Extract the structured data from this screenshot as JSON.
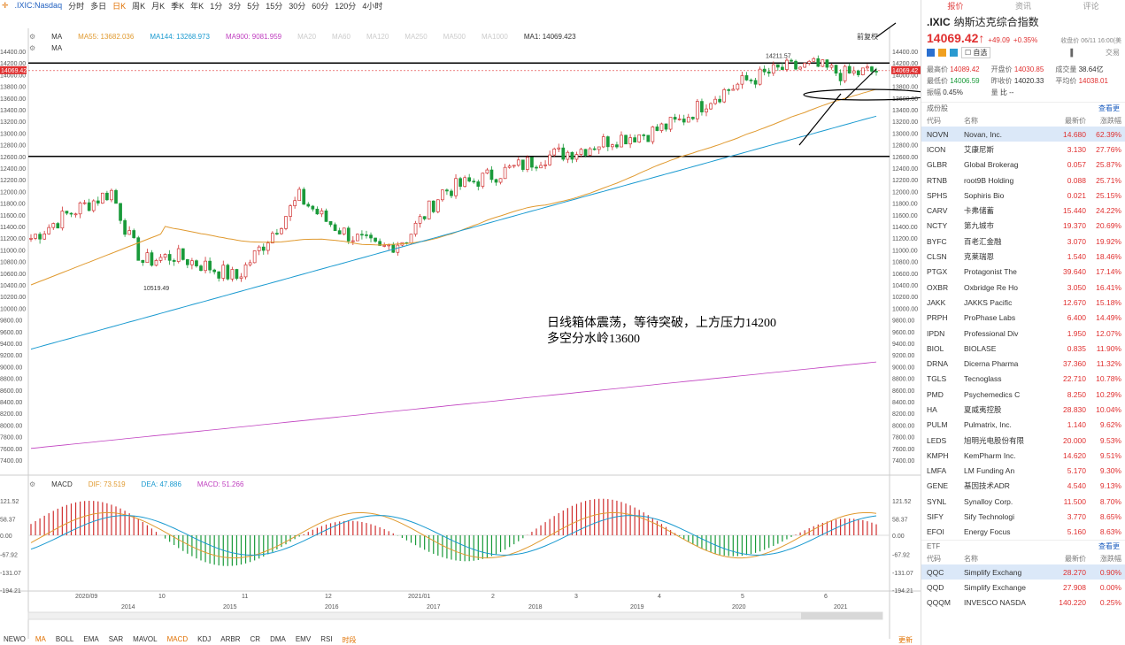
{
  "toolbar": {
    "symbol": ".IXIC:Nasdaq",
    "periods": [
      "分时",
      "多日",
      "日K",
      "周K",
      "月K",
      "季K",
      "年K",
      "1分",
      "3分",
      "5分",
      "15分",
      "30分",
      "60分",
      "120分",
      "4小时"
    ],
    "active_period": "日K"
  },
  "ma_bar": {
    "label": "MA",
    "items": [
      {
        "name": "MA55: 13682.036",
        "color": "#e09a30"
      },
      {
        "name": "MA144: 13268.973",
        "color": "#1a9ad0"
      },
      {
        "name": "MA900: 9081.959",
        "color": "#c040c0"
      },
      {
        "name": "MA20",
        "color": "#ccc"
      },
      {
        "name": "MA60",
        "color": "#ccc"
      },
      {
        "name": "MA120",
        "color": "#ccc"
      },
      {
        "name": "MA250",
        "color": "#ccc"
      },
      {
        "name": "MA500",
        "color": "#ccc"
      },
      {
        "name": "MA1000",
        "color": "#ccc"
      },
      {
        "name": "MA1: 14069.423",
        "color": "#333"
      }
    ],
    "adjust": "前复权",
    "second_label": "MA"
  },
  "macd_bar": {
    "label": "MACD",
    "dif": "DIF: 73.519",
    "dea": "DEA: 47.886",
    "macd": "MACD: 51.266"
  },
  "price_labels": {
    "left": "14069.42",
    "right": "14069.42",
    "high": "14211.57",
    "low": "10519.49"
  },
  "annotation": {
    "line1": "日线箱体震荡，等待突破，上方压力14200",
    "line2": "多空分水岭13600"
  },
  "price_axis": [
    "14400.00",
    "14200.00",
    "14000.00",
    "13800.00",
    "13600.00",
    "13400.00",
    "13200.00",
    "13000.00",
    "12800.00",
    "12600.00",
    "12400.00",
    "12200.00",
    "12000.00",
    "11800.00",
    "11600.00",
    "11400.00",
    "11200.00",
    "11000.00",
    "10800.00",
    "10600.00",
    "10400.00",
    "10200.00",
    "10000.00",
    "9800.00",
    "9600.00",
    "9400.00",
    "9200.00",
    "9000.00",
    "8800.00",
    "8600.00",
    "8400.00",
    "8200.00",
    "8000.00",
    "7800.00",
    "7600.00",
    "7400.00"
  ],
  "macd_axis": [
    "121.52",
    "58.37",
    "0.00",
    "-67.92",
    "-131.07",
    "-194.21"
  ],
  "month_labels": [
    "2020/09",
    "10",
    "11",
    "12",
    "2021/01",
    "2",
    "3",
    "4",
    "5",
    "6"
  ],
  "year_labels": [
    "2014",
    "2015",
    "2016",
    "2017",
    "2018",
    "2019",
    "2020",
    "2021"
  ],
  "bottom_tabs": [
    "NEWO",
    "MA",
    "BOLL",
    "EMA",
    "SAR",
    "MAVOL",
    "MACD",
    "KDJ",
    "ARBR",
    "CR",
    "DMA",
    "EMV",
    "RSI",
    "时段"
  ],
  "bottom_active": [
    "MA",
    "MACD"
  ],
  "bottom_right": "更新",
  "quote": {
    "tabs": [
      "报价",
      "资讯",
      "评论"
    ],
    "code": ".IXIC",
    "name": "纳斯达克综合指数",
    "price": "14069.42",
    "arrow": "↑",
    "change": "+49.09",
    "change_pct": "+0.35%",
    "time": "收盘价 06/11 16:00(美",
    "watch": "自选",
    "trade": "交易",
    "stats": [
      [
        {
          "k": "最高价",
          "v": "14089.42",
          "c": "red"
        },
        {
          "k": "开盘价",
          "v": "14030.85",
          "c": "red"
        },
        {
          "k": "成交量",
          "v": "38.64亿",
          "c": ""
        }
      ],
      [
        {
          "k": "最低价",
          "v": "14006.59",
          "c": "green"
        },
        {
          "k": "昨收价",
          "v": "14020.33",
          "c": ""
        },
        {
          "k": "平均价",
          "v": "14038.01",
          "c": "red"
        }
      ],
      [
        {
          "k": "振幅",
          "v": "0.45%",
          "c": ""
        },
        {
          "k": "量",
          "v": "比 --",
          "c": ""
        },
        {
          "k": "",
          "v": "",
          "c": ""
        }
      ]
    ]
  },
  "constituents": {
    "title": "成份股",
    "link": "查看更",
    "headers": [
      "代码",
      "名称",
      "最新价",
      "涨跌幅"
    ],
    "rows": [
      {
        "code": "NOVN",
        "name": "Novan, Inc.",
        "price": "14.680",
        "pct": "62.39%",
        "sel": true
      },
      {
        "code": "ICON",
        "name": "艾康尼斯",
        "price": "3.130",
        "pct": "27.76%"
      },
      {
        "code": "GLBR",
        "name": "Global Brokerag",
        "price": "0.057",
        "pct": "25.87%"
      },
      {
        "code": "RTNB",
        "name": "root9B Holding",
        "price": "0.088",
        "pct": "25.71%"
      },
      {
        "code": "SPHS",
        "name": "Sophiris Bio",
        "price": "0.021",
        "pct": "25.15%"
      },
      {
        "code": "CARV",
        "name": "卡弗储蓄",
        "price": "15.440",
        "pct": "24.22%"
      },
      {
        "code": "NCTY",
        "name": "第九城市",
        "price": "19.370",
        "pct": "20.69%"
      },
      {
        "code": "BYFC",
        "name": "百老汇金融",
        "price": "3.070",
        "pct": "19.92%"
      },
      {
        "code": "CLSN",
        "name": "克莱瑞恩",
        "price": "1.540",
        "pct": "18.46%"
      },
      {
        "code": "PTGX",
        "name": "Protagonist The",
        "price": "39.640",
        "pct": "17.14%"
      },
      {
        "code": "OXBR",
        "name": "Oxbridge Re Ho",
        "price": "3.050",
        "pct": "16.41%"
      },
      {
        "code": "JAKK",
        "name": "JAKKS Pacific",
        "price": "12.670",
        "pct": "15.18%"
      },
      {
        "code": "PRPH",
        "name": "ProPhase Labs",
        "price": "6.400",
        "pct": "14.49%"
      },
      {
        "code": "IPDN",
        "name": "Professional Div",
        "price": "1.950",
        "pct": "12.07%"
      },
      {
        "code": "BIOL",
        "name": "BIOLASE",
        "price": "0.835",
        "pct": "11.90%"
      },
      {
        "code": "DRNA",
        "name": "Dicerna Pharma",
        "price": "37.360",
        "pct": "11.32%"
      },
      {
        "code": "TGLS",
        "name": "Tecnoglass",
        "price": "22.710",
        "pct": "10.78%"
      },
      {
        "code": "PMD",
        "name": "Psychemedics C",
        "price": "8.250",
        "pct": "10.29%"
      },
      {
        "code": "HA",
        "name": "夏威夷控股",
        "price": "28.830",
        "pct": "10.04%"
      },
      {
        "code": "PULM",
        "name": "Pulmatrix, Inc.",
        "price": "1.140",
        "pct": "9.62%"
      },
      {
        "code": "LEDS",
        "name": "旭明光电股份有限",
        "price": "20.000",
        "pct": "9.53%"
      },
      {
        "code": "KMPH",
        "name": "KemPharm Inc.",
        "price": "14.620",
        "pct": "9.51%"
      },
      {
        "code": "LMFA",
        "name": "LM Funding An",
        "price": "5.170",
        "pct": "9.30%"
      },
      {
        "code": "GENE",
        "name": "基因技术ADR",
        "price": "4.540",
        "pct": "9.13%"
      },
      {
        "code": "SYNL",
        "name": "Synalloy Corp.",
        "price": "11.500",
        "pct": "8.70%"
      },
      {
        "code": "SIFY",
        "name": "Sify Technologi",
        "price": "3.770",
        "pct": "8.65%"
      },
      {
        "code": "EFOI",
        "name": "Energy Focus",
        "price": "5.160",
        "pct": "8.63%"
      }
    ]
  },
  "etf": {
    "title": "ETF",
    "link": "查看更",
    "headers": [
      "代码",
      "名称",
      "最新价",
      "涨跌幅"
    ],
    "rows": [
      {
        "code": "QQC",
        "name": "Simplify Exchang",
        "price": "28.270",
        "pct": "0.90%",
        "sel": true
      },
      {
        "code": "QQD",
        "name": "Simplify Exchange",
        "price": "27.908",
        "pct": "0.00%"
      },
      {
        "code": "QQQM",
        "name": "INVESCO NASDA",
        "price": "140.220",
        "pct": "0.25%"
      }
    ]
  }
}
